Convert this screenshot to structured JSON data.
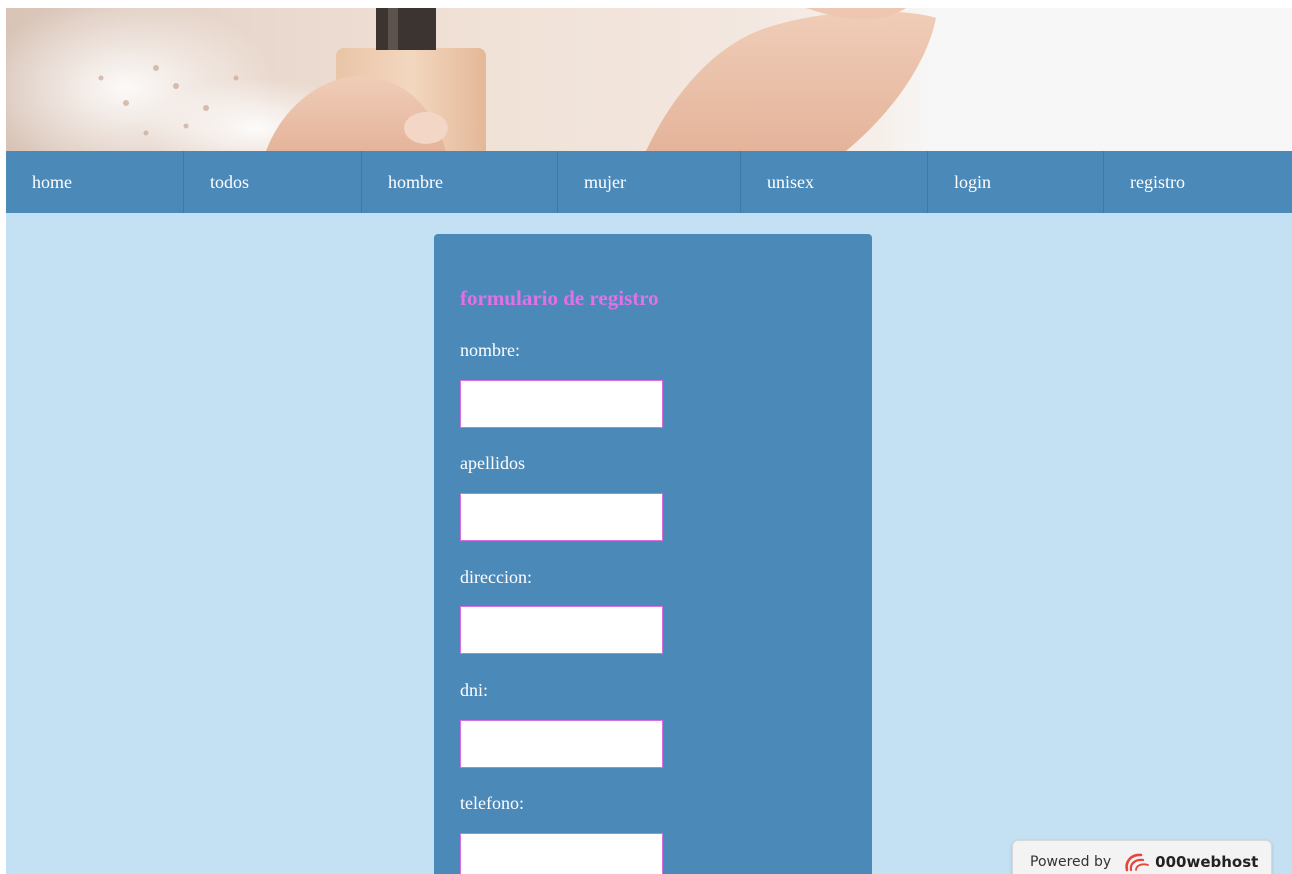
{
  "nav": {
    "items": [
      {
        "label": "home"
      },
      {
        "label": "todos"
      },
      {
        "label": "hombre"
      },
      {
        "label": "mujer"
      },
      {
        "label": "unisex"
      },
      {
        "label": "login"
      },
      {
        "label": "registro"
      }
    ]
  },
  "form": {
    "title": "formulario de registro",
    "fields": [
      {
        "label": "nombre:",
        "value": ""
      },
      {
        "label": "apellidos",
        "value": ""
      },
      {
        "label": "direccion:",
        "value": ""
      },
      {
        "label": "dni:",
        "value": ""
      },
      {
        "label": "telefono:",
        "value": ""
      }
    ]
  },
  "badge": {
    "prefix": "Powered by",
    "brand": "000webhost",
    "icon": "000webhost-swirl-icon"
  },
  "colors": {
    "page_bg": "#c3e1f2",
    "nav_bg": "#4b89b9",
    "card_bg": "#4b89b9",
    "title_color": "#e270e6",
    "input_border": "#d76fe0"
  }
}
